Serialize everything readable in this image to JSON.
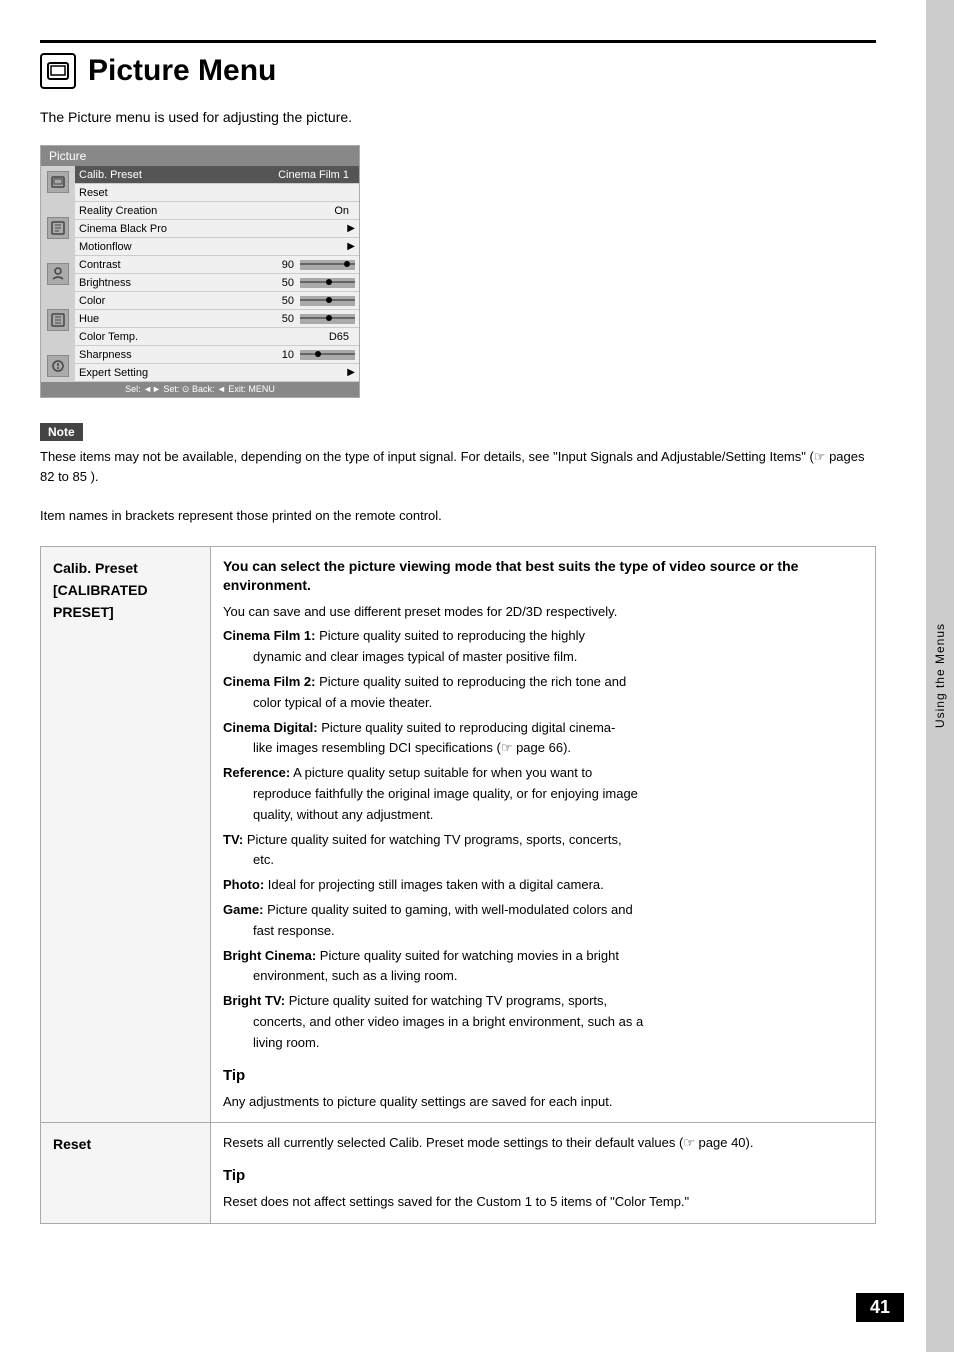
{
  "page": {
    "number": "41",
    "side_tab_text": "Using the Menus"
  },
  "header": {
    "icon_symbol": "🏠",
    "title": "Picture Menu"
  },
  "intro": {
    "text": "The Picture menu is used for adjusting the picture."
  },
  "menu_screenshot": {
    "title": "Picture",
    "items": [
      {
        "name": "Calib. Preset",
        "value": "Cinema Film 1",
        "type": "selected"
      },
      {
        "name": "Reset",
        "value": "",
        "type": "normal"
      },
      {
        "name": "Reality Creation",
        "value": "On",
        "type": "normal"
      },
      {
        "name": "Cinema Black Pro",
        "value": "",
        "type": "normal",
        "arrow": true
      },
      {
        "name": "Motionflow",
        "value": "",
        "type": "normal",
        "arrow": true
      },
      {
        "name": "Contrast",
        "value": "90",
        "type": "slider",
        "position": 85
      },
      {
        "name": "Brightness",
        "value": "50",
        "type": "slider",
        "position": 50
      },
      {
        "name": "Color",
        "value": "50",
        "type": "slider",
        "position": 50
      },
      {
        "name": "Hue",
        "value": "50",
        "type": "slider",
        "position": 50
      },
      {
        "name": "Color Temp.",
        "value": "D65",
        "type": "normal"
      },
      {
        "name": "Sharpness",
        "value": "10",
        "type": "slider",
        "position": 30
      },
      {
        "name": "Expert Setting",
        "value": "",
        "type": "normal",
        "arrow": true
      }
    ],
    "bottom_bar": "Sel: ◄► Set: ⊙ Back: ◄ Exit: MENU"
  },
  "note": {
    "label": "Note",
    "text": "These items may not be available, depending on the type of input signal. For details, see \"Input Signals and Adjustable/Setting Items\" (☞ pages 82 to 85 )."
  },
  "item_names_note": "Item names in brackets represent those printed on the remote control.",
  "table_rows": [
    {
      "term": "Calib. Preset",
      "term2": "[CALIBRATED PRESET]",
      "desc_heading": "You can select the picture viewing mode that best suits the type of video source or the environment.",
      "desc_intro": "You can save and use different preset modes for 2D/3D respectively.",
      "items": [
        {
          "bold": "Cinema Film 1:",
          "text": " Picture quality suited to reproducing the highly dynamic and clear images typical of master positive film."
        },
        {
          "bold": "Cinema Film 2:",
          "text": " Picture quality suited to reproducing the rich tone and color typical of a movie theater."
        },
        {
          "bold": "Cinema Digital:",
          "text": " Picture quality suited to reproducing digital cinema-like images resembling DCI specifications (☞ page 66)."
        },
        {
          "bold": "Reference:",
          "text": " A picture quality setup suitable for when you want to reproduce faithfully the original image quality, or for enjoying image quality, without any adjustment."
        },
        {
          "bold": "TV:",
          "text": " Picture quality suited for watching TV programs, sports, concerts, etc."
        },
        {
          "bold": "Photo:",
          "text": " Ideal for projecting still images taken with a digital camera."
        },
        {
          "bold": "Game:",
          "text": " Picture quality suited to gaming, with well-modulated colors and fast response."
        },
        {
          "bold": "Bright Cinema:",
          "text": " Picture quality suited for watching movies in a bright environment, such as a living room."
        },
        {
          "bold": "Bright TV:",
          "text": " Picture quality suited for watching TV programs, sports, concerts, and other video images in a bright environment, such as a living room."
        }
      ],
      "tip_heading": "Tip",
      "tip_text": "Any adjustments to picture quality settings are saved for each input."
    },
    {
      "term": "Reset",
      "term2": "",
      "desc_heading": "",
      "desc_intro": "Resets all currently selected Calib. Preset mode settings to their default values (☞ page 40).",
      "items": [],
      "tip_heading": "Tip",
      "tip_text": "Reset does not affect settings saved for the Custom 1 to 5 items of \"Color Temp.\""
    }
  ]
}
